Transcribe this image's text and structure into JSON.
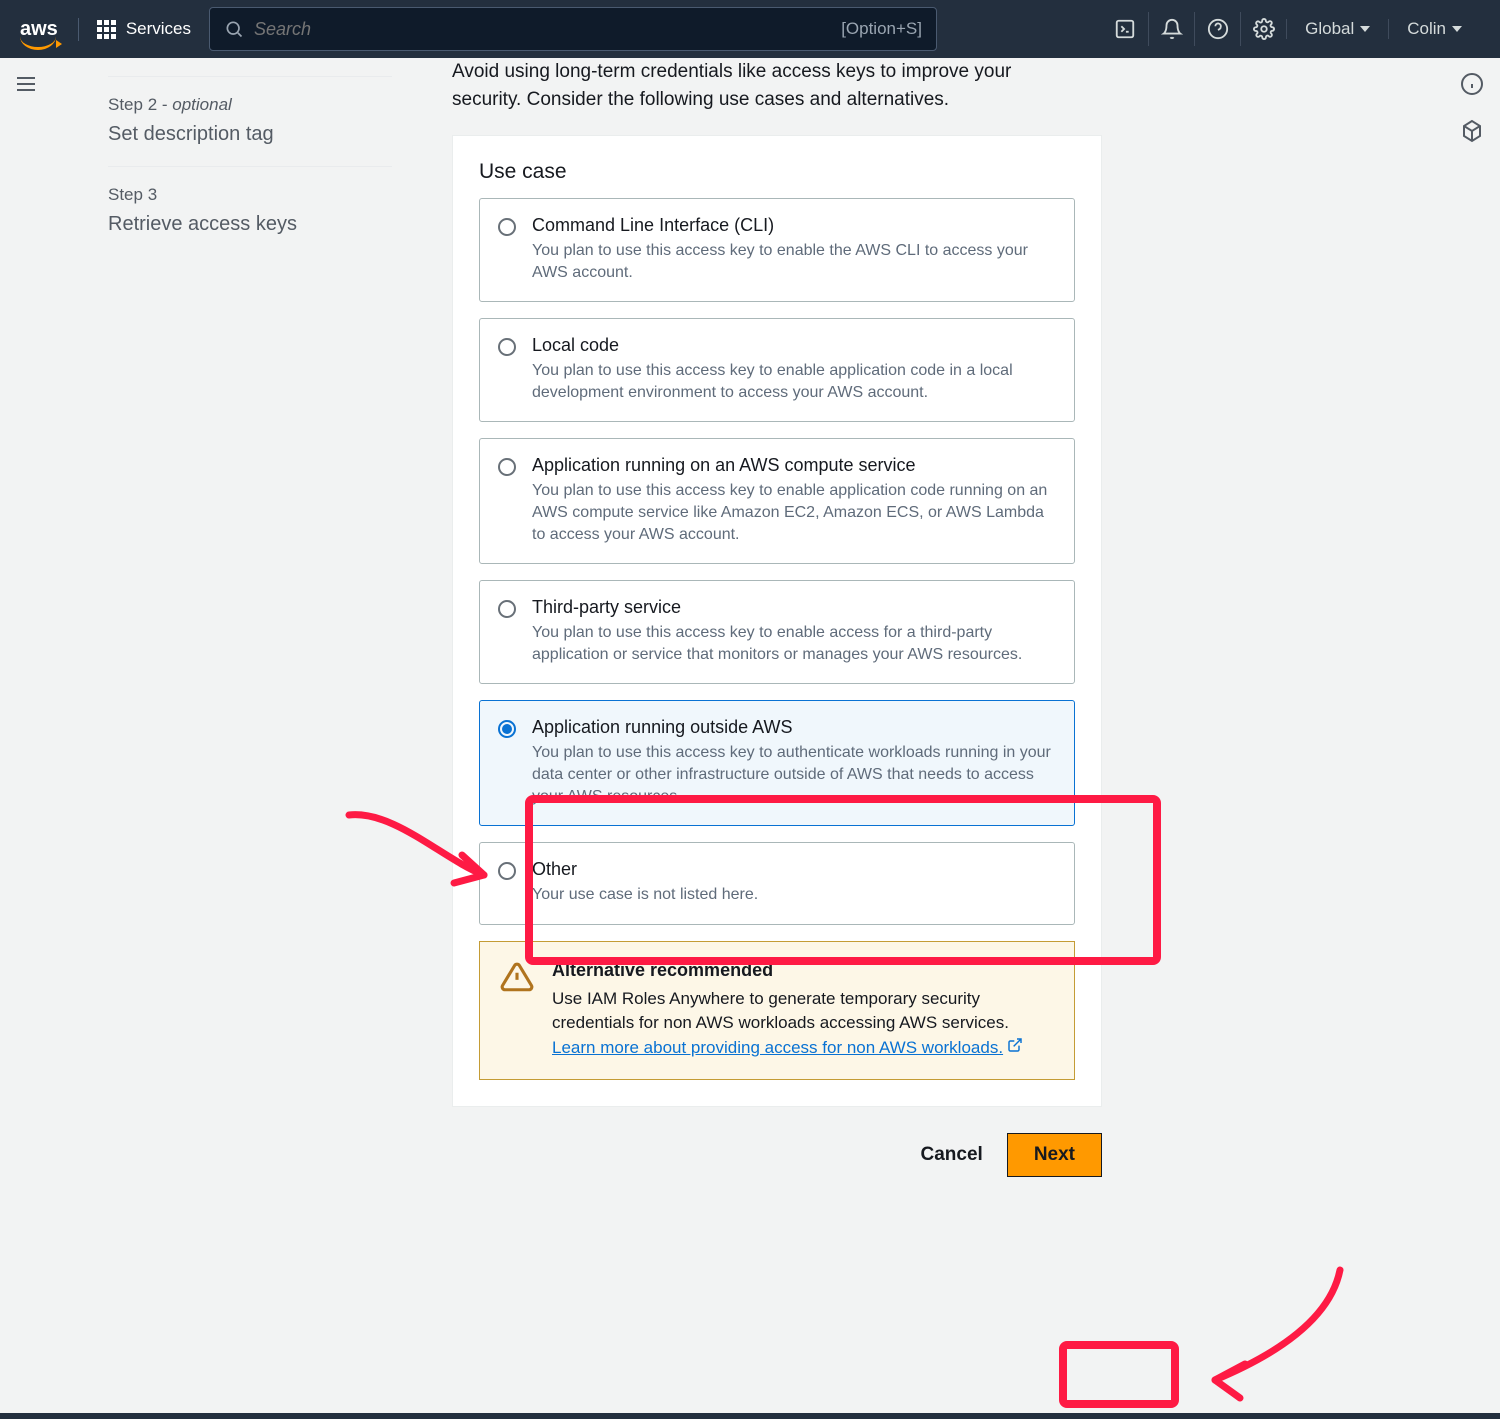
{
  "nav": {
    "services_label": "Services",
    "search_placeholder": "Search",
    "search_kbd": "[Option+S]",
    "region": "Global",
    "user": "Colin"
  },
  "sidebar": {
    "steps": [
      {
        "label": "",
        "optional": "",
        "title": ""
      },
      {
        "label": "Step 2 - ",
        "optional": "optional",
        "title": "Set description tag"
      },
      {
        "label": "Step 3",
        "optional": "",
        "title": "Retrieve access keys"
      }
    ]
  },
  "intro": "Avoid using long-term credentials like access keys to improve your security. Consider the following use cases and alternatives.",
  "panel": {
    "heading": "Use case",
    "usecases": [
      {
        "title": "Command Line Interface (CLI)",
        "desc": "You plan to use this access key to enable the AWS CLI to access your AWS account.",
        "selected": false
      },
      {
        "title": "Local code",
        "desc": "You plan to use this access key to enable application code in a local development environment to access your AWS account.",
        "selected": false
      },
      {
        "title": "Application running on an AWS compute service",
        "desc": "You plan to use this access key to enable application code running on an AWS compute service like Amazon EC2, Amazon ECS, or AWS Lambda to access your AWS account.",
        "selected": false
      },
      {
        "title": "Third-party service",
        "desc": "You plan to use this access key to enable access for a third-party application or service that monitors or manages your AWS resources.",
        "selected": false
      },
      {
        "title": "Application running outside AWS",
        "desc": "You plan to use this access key to authenticate workloads running in your data center or other infrastructure outside of AWS that needs to access your AWS resources.",
        "selected": true
      },
      {
        "title": "Other",
        "desc": "Your use case is not listed here.",
        "selected": false
      }
    ],
    "alert": {
      "title": "Alternative recommended",
      "body": "Use IAM Roles Anywhere to generate temporary security credentials for non AWS workloads accessing AWS services. ",
      "link": "Learn more about providing access for non AWS workloads."
    }
  },
  "actions": {
    "cancel": "Cancel",
    "next": "Next"
  }
}
